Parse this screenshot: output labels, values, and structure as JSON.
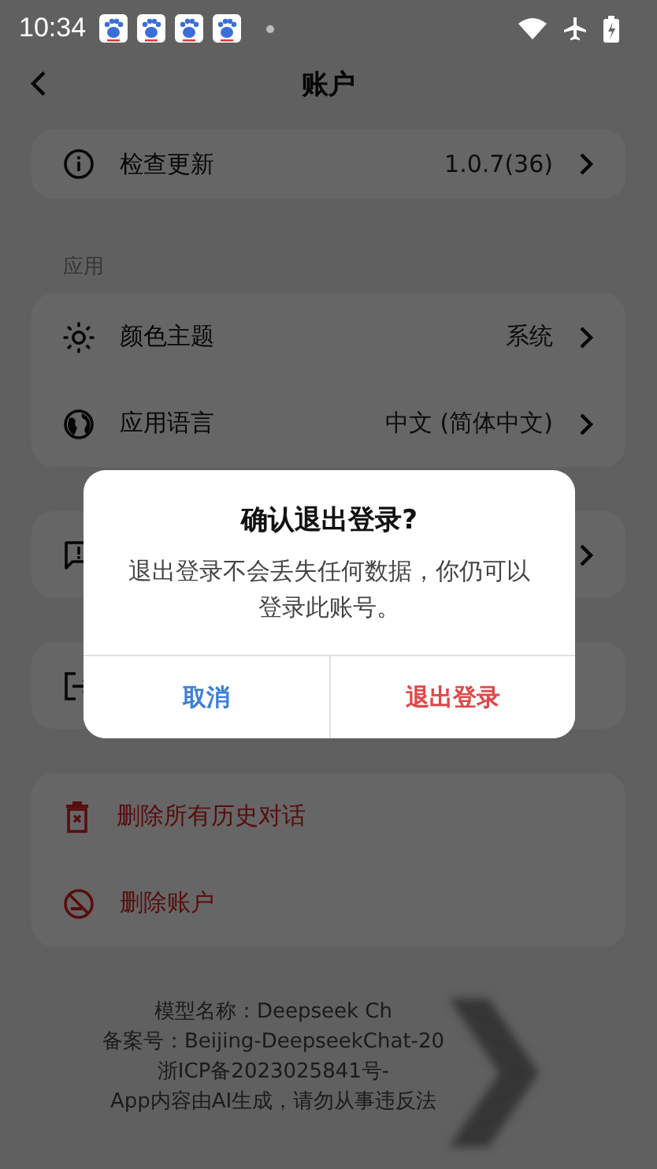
{
  "status_bar": {
    "time": "10:34"
  },
  "header": {
    "title": "账户"
  },
  "groups": [
    {
      "rows": [
        {
          "label": "检查更新",
          "value": "1.0.7(36)",
          "chevron": true,
          "danger": false
        }
      ]
    },
    {
      "label": "应用",
      "rows": [
        {
          "label": "颜色主题",
          "value": "系统",
          "chevron": true,
          "danger": false
        },
        {
          "label": "应用语言",
          "value": "中文 (简体中文)",
          "chevron": true,
          "danger": false
        }
      ]
    },
    {
      "rows": [
        {
          "chevron": true
        }
      ]
    },
    {
      "rows": [
        {
          "chevron": false
        }
      ]
    },
    {
      "rows": [
        {
          "label": "删除所有历史对话",
          "chevron": false,
          "danger": true
        },
        {
          "label": "删除账户",
          "chevron": false,
          "danger": true
        }
      ]
    }
  ],
  "footer": [
    "模型名称：Deepseek Ch",
    "备案号：Beijing-DeepseekChat-20",
    "浙ICP备2023025841号-",
    "App内容由AI生成，请勿从事违反法"
  ],
  "dialog": {
    "title": "确认退出登录?",
    "message": "退出登录不会丢失任何数据，你仍可以登录此账号。",
    "buttons": [
      {
        "label": "取消",
        "kind": "cancel"
      },
      {
        "label": "退出登录",
        "kind": "destructive"
      }
    ]
  }
}
